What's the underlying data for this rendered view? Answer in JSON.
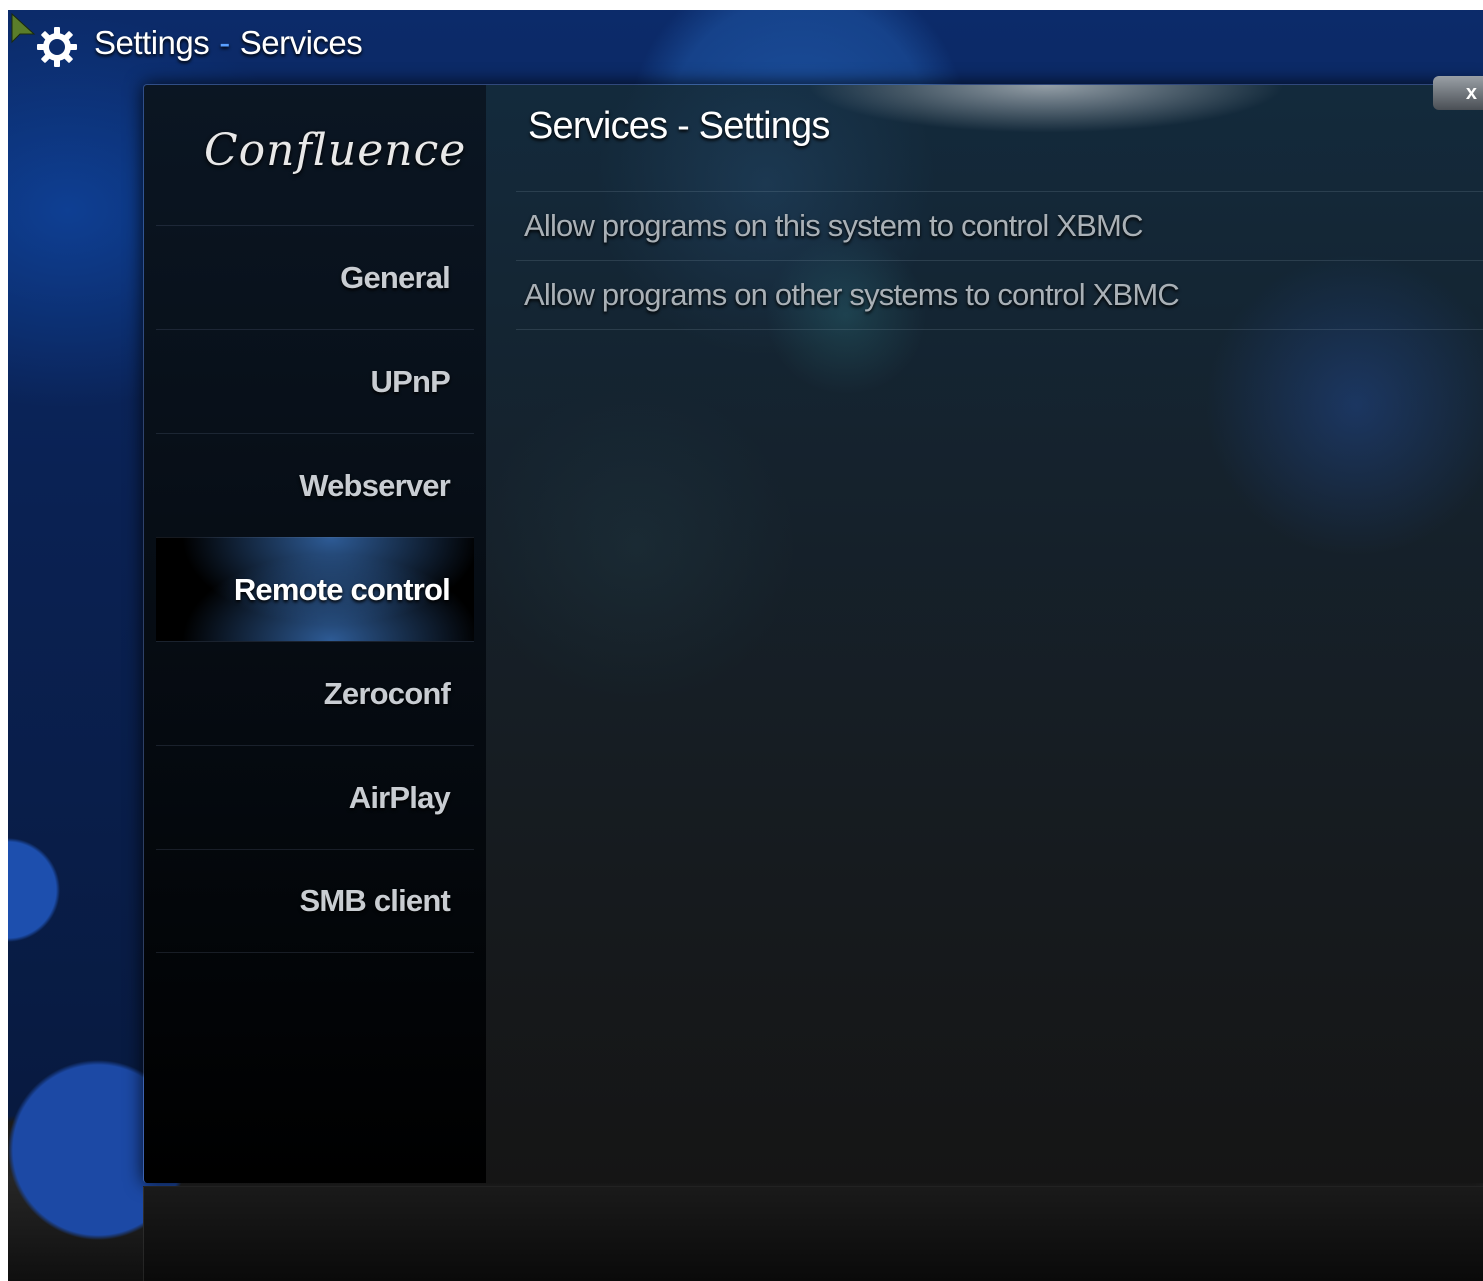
{
  "header": {
    "section": "Settings",
    "separator": "-",
    "subsection": "Services",
    "icon": "gear-icon"
  },
  "dialog": {
    "logo": "Confluence",
    "title": "Services - Settings",
    "close_label": "x"
  },
  "sidebar": {
    "items": [
      {
        "label": "General",
        "active": false
      },
      {
        "label": "UPnP",
        "active": false
      },
      {
        "label": "Webserver",
        "active": false
      },
      {
        "label": "Remote control",
        "active": true
      },
      {
        "label": "Zeroconf",
        "active": false
      },
      {
        "label": "AirPlay",
        "active": false
      },
      {
        "label": "SMB client",
        "active": false
      }
    ]
  },
  "settings": {
    "items": [
      {
        "label": "Allow programs on this system to control XBMC"
      },
      {
        "label": "Allow programs on other systems to control XBMC"
      }
    ]
  },
  "colors": {
    "accent": "#3c7bd6",
    "separator_blue": "#5aa0ff"
  }
}
